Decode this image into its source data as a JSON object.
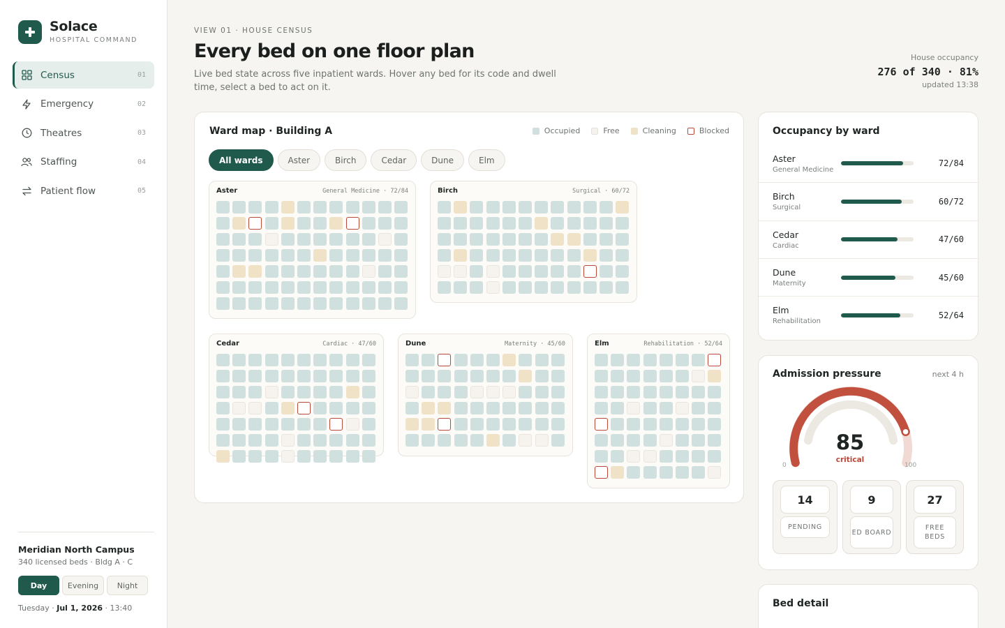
{
  "brand": {
    "name": "Solace",
    "subtitle": "HOSPITAL COMMAND"
  },
  "nav": [
    {
      "label": "Census",
      "num": "01",
      "icon": "grid-icon",
      "active": true
    },
    {
      "label": "Emergency",
      "num": "02",
      "icon": "bolt-icon",
      "active": false
    },
    {
      "label": "Theatres",
      "num": "03",
      "icon": "clock-icon",
      "active": false
    },
    {
      "label": "Staffing",
      "num": "04",
      "icon": "people-icon",
      "active": false
    },
    {
      "label": "Patient flow",
      "num": "05",
      "icon": "transfer-icon",
      "active": false
    }
  ],
  "campus": {
    "name": "Meridian North Campus",
    "sub": "340 licensed beds · Bldg A · C",
    "shifts": [
      "Day",
      "Evening",
      "Night"
    ],
    "active_shift": "Day",
    "date_prefix": "Tuesday · ",
    "date": "Jul 1, 2026",
    "time": " · 13:40"
  },
  "header": {
    "eyebrow": "VIEW 01 · HOUSE CENSUS",
    "title": "Every bed on one floor plan",
    "description": "Live bed state across five inpatient wards. Hover any bed for its code and dwell time, select a bed to act on it.",
    "occupancy_label": "House occupancy",
    "occupancy_value": "276 of 340 · 81%",
    "updated": "updated 13:38"
  },
  "map": {
    "title": "Ward map · Building A",
    "legend": [
      {
        "label": "Occupied",
        "color": "#cfe0de"
      },
      {
        "label": "Free",
        "color": "#f6f3ee"
      },
      {
        "label": "Cleaning",
        "color": "#efe2c6"
      },
      {
        "label": "Blocked",
        "color": "#b8483a"
      }
    ],
    "filters": [
      "All wards",
      "Aster",
      "Birch",
      "Cedar",
      "Dune",
      "Elm"
    ],
    "active_filter": "All wards",
    "wards": [
      {
        "name": "Aster",
        "meta": "General Medicine · 72/84",
        "cols": 12,
        "rows": [
          "oooocooooooo",
          "ocbocoocbooo",
          "ooofoooooofo",
          "oooooocooooo",
          "occoooooofoo",
          "oooooooooooo",
          "oooooooooooo"
        ]
      },
      {
        "name": "Birch",
        "meta": "Surgical · 60/72",
        "cols": 12,
        "rows": [
          "ocoooooooooc",
          "oooooocoooooc",
          "oooooooccoooo",
          "ocooooooocooo",
          "ffofoooooboo",
          "ooofoooooooo"
        ]
      },
      {
        "name": "Cedar",
        "meta": "Cardiac · 47/60",
        "cols": 10,
        "rows": [
          "oooooooooo",
          "oooooooooo",
          "ooofoooocoo",
          "offocbooooo",
          "ooooooobfoo",
          "oooofoooooo",
          "cooofooooo"
        ]
      },
      {
        "name": "Dune",
        "meta": "Maternity · 45/60",
        "cols": 10,
        "rows": [
          "oobooocoooo",
          "ooooooocoo",
          "fooofffooo",
          "occoooooooo",
          "ccboooooooo",
          "ooooocoffoo"
        ]
      },
      {
        "name": "Elm",
        "meta": "Rehabilitation · 52/64",
        "cols": 8,
        "rows": [
          "ooooooob",
          "oooooofc",
          "oooooooo",
          "oofoofoo",
          "booooooo",
          "oooofooo",
          "ooffoooo",
          "bcooooofo"
        ]
      }
    ]
  },
  "occupancy": {
    "title": "Occupancy by ward",
    "rows": [
      {
        "ward": "Aster",
        "service": "General Medicine",
        "value": "72/84",
        "ratio": 0.857
      },
      {
        "ward": "Birch",
        "service": "Surgical",
        "value": "60/72",
        "ratio": 0.833
      },
      {
        "ward": "Cedar",
        "service": "Cardiac",
        "value": "47/60",
        "ratio": 0.783
      },
      {
        "ward": "Dune",
        "service": "Maternity",
        "value": "45/60",
        "ratio": 0.75
      },
      {
        "ward": "Elm",
        "service": "Rehabilitation",
        "value": "52/64",
        "ratio": 0.8125
      }
    ]
  },
  "admission": {
    "title": "Admission pressure",
    "window": "next 4 h",
    "value": "85",
    "status": "critical",
    "min": "0",
    "max": "100",
    "stats": [
      {
        "num": "14",
        "label": "PENDING"
      },
      {
        "num": "9",
        "label": "ED BOARD"
      },
      {
        "num": "27",
        "label": "FREE BEDS"
      }
    ],
    "colors": {
      "arc": "#c2503f",
      "track": "#ece9e3"
    }
  },
  "bed_detail": {
    "title": "Bed detail"
  }
}
